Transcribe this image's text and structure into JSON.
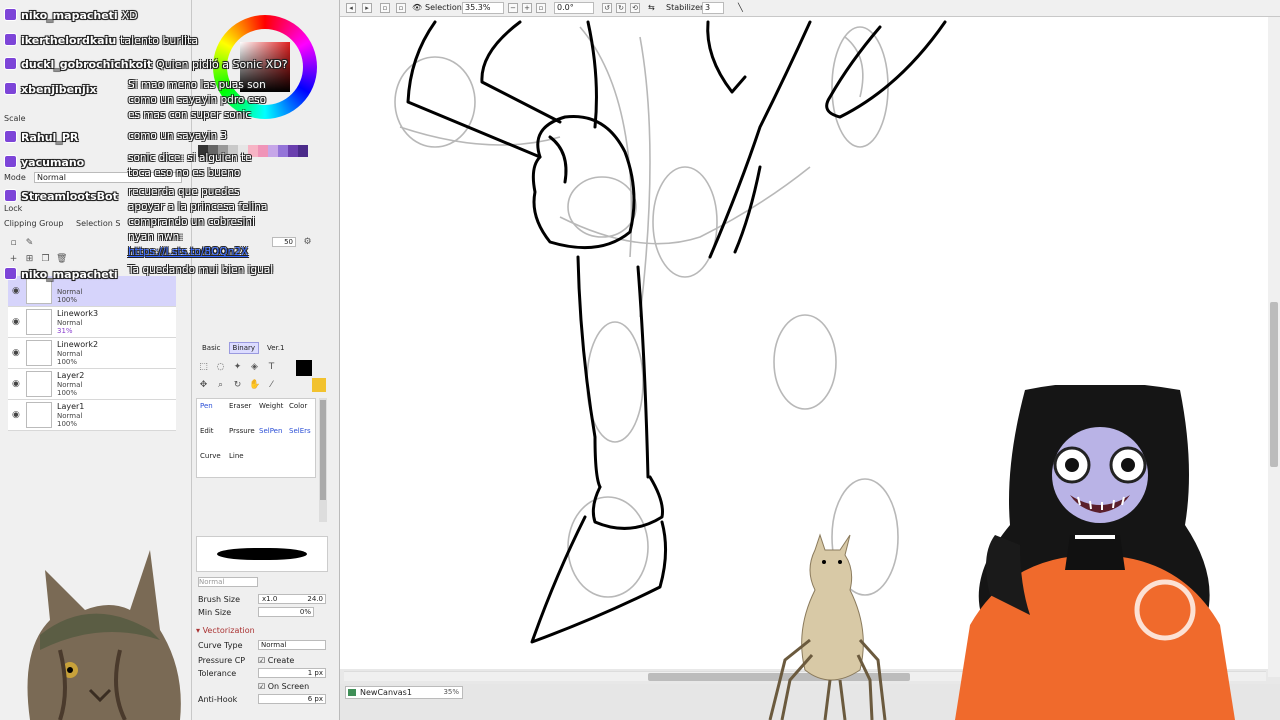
{
  "toolbar": {
    "selection_label": "Selection",
    "zoom": "35.3%",
    "rotation": "0.0°",
    "stabilizer_label": "Stabilizer",
    "stabilizer_value": "3"
  },
  "layer_panel": {
    "scale_label": "Scale",
    "mode_label": "Mode",
    "mode_value": "Normal",
    "lock_label": "Lock",
    "clipping_label": "Clipping Group",
    "selection_source_label": "Selection S",
    "layers": [
      {
        "name": "",
        "mode": "Normal",
        "opacity": "100%",
        "active": true
      },
      {
        "name": "Linework3",
        "mode": "Normal",
        "opacity": "31%",
        "active": false
      },
      {
        "name": "Linework2",
        "mode": "Normal",
        "opacity": "100%",
        "active": false
      },
      {
        "name": "Layer2",
        "mode": "Normal",
        "opacity": "100%",
        "active": false
      },
      {
        "name": "Layer1",
        "mode": "Normal",
        "opacity": "100%",
        "active": false
      }
    ]
  },
  "tool_panel": {
    "brush_size_small": "50",
    "tabs": [
      "Basic",
      "Binary",
      "Ver.1"
    ],
    "selected_tab": "Binary",
    "tools_row1": [
      "Pen",
      "Eraser",
      "Weight",
      "Color"
    ],
    "tools_row2": [
      "Edit",
      "Prssure",
      "SelPen",
      "SelErs"
    ],
    "tools_row3": [
      "Curve",
      "Line"
    ],
    "blend_mode": "Normal",
    "brush_size_label": "Brush Size",
    "brush_size_multiplier": "x1.0",
    "brush_size_value": "24.0",
    "min_size_label": "Min Size",
    "min_size_value": "0%",
    "vectorization_label": "Vectorization",
    "curve_type_label": "Curve Type",
    "curve_type_value": "Normal",
    "pressure_cp_label": "Pressure CP",
    "create_label": "Create",
    "tolerance_label": "Tolerance",
    "tolerance_value": "1 px",
    "on_screen_label": "On Screen",
    "anti_hook_label": "Anti-Hook",
    "anti_hook_value": "6 px"
  },
  "status": {
    "doc_name": "NewCanvas1",
    "doc_zoom": "35%"
  },
  "chat": [
    {
      "user": "niko_mapacheti",
      "message": "XD",
      "inline": true
    },
    {
      "user": "ikerthelordkaiu",
      "message": "talento burlita",
      "inline": true
    },
    {
      "user": "duckl_gobrochichkoit",
      "message": "Quien pidió a Sonic XD?",
      "inline": true
    },
    {
      "user": "xbenjibenjix",
      "message_lines": [
        "Si mao meno las puas son",
        "como un sayayin pdro eso",
        "es mas con super sonic",
        "como un sayayin 3"
      ]
    },
    {
      "user": "Rahul_PR",
      "message_lines": []
    },
    {
      "user": "yacumano",
      "message_lines": [
        "sonic dice: si alguien te",
        "toca eso no es bueno"
      ]
    },
    {
      "user": "StreamlootsBot",
      "message_lines": [
        "recuerda que puedes",
        "apoyar a la princesa felina",
        "comprando un cobresini",
        "nyan nwn:"
      ]
    },
    {
      "user": "",
      "message_lines": [
        "https://l.sts.to/8OQn2X"
      ],
      "link": true
    },
    {
      "user": "niko_mapacheti",
      "message_lines": [
        "Ta quedando mui bien igual"
      ]
    }
  ],
  "colors": {
    "twitch_purple": "#7d45d8",
    "active_layer": "#d6d4fb",
    "link_blue": "#3b6cff",
    "avatar_orange": "#f06a2c"
  },
  "icons": [
    "eye-icon",
    "pencil-icon",
    "lock-icon",
    "trash-icon",
    "gear-icon",
    "text-icon",
    "zoom-icon",
    "rotate-icon",
    "hand-icon"
  ]
}
